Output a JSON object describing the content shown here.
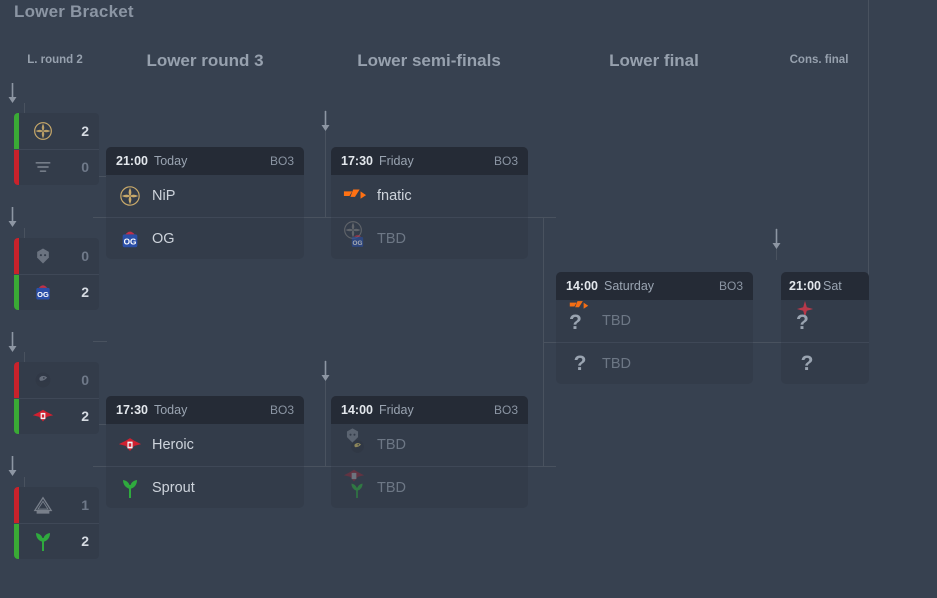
{
  "title": "Lower Bracket",
  "columns": [
    {
      "label": "L. round 2",
      "size": "small"
    },
    {
      "label": "Lower round 3",
      "size": "big"
    },
    {
      "label": "Lower semi-finals",
      "size": "big"
    },
    {
      "label": "Lower final",
      "size": "big"
    },
    {
      "label": "Cons. final",
      "size": "small"
    }
  ],
  "colors": {
    "background": "#374150",
    "card_body": "#333c4a",
    "card_header": "#252b36",
    "win_bar": "#3aaa35",
    "lose_bar": "#c9222b",
    "connector": "#49525f",
    "text_primary": "#cdd3db",
    "text_muted": "#6d7785"
  },
  "round2": {
    "matches": [
      {
        "teams": [
          {
            "logo": "nip-logo",
            "score": "2",
            "result": "win"
          },
          {
            "logo": "faze-logo",
            "score": "0",
            "result": "lose"
          }
        ]
      },
      {
        "teams": [
          {
            "logo": "big-logo",
            "score": "0",
            "result": "lose"
          },
          {
            "logo": "og-logo",
            "score": "2",
            "result": "win"
          }
        ]
      },
      {
        "teams": [
          {
            "logo": "godsent-logo",
            "score": "0",
            "result": "lose"
          },
          {
            "logo": "heroic-logo",
            "score": "2",
            "result": "win"
          }
        ]
      },
      {
        "teams": [
          {
            "logo": "mousesports-logo",
            "score": "1",
            "result": "lose"
          },
          {
            "logo": "sprout-logo",
            "score": "2",
            "result": "win"
          }
        ]
      }
    ]
  },
  "round3": {
    "matches": [
      {
        "time": "21:00",
        "day": "Today",
        "format": "BO3",
        "teams": [
          {
            "name": "NiP",
            "logo": "nip-logo",
            "state": "known"
          },
          {
            "name": "OG",
            "logo": "og-logo",
            "state": "known"
          }
        ]
      },
      {
        "time": "17:30",
        "day": "Today",
        "format": "BO3",
        "teams": [
          {
            "name": "Heroic",
            "logo": "heroic-logo",
            "state": "known"
          },
          {
            "name": "Sprout",
            "logo": "sprout-logo",
            "state": "known"
          }
        ]
      }
    ]
  },
  "semifinals": {
    "matches": [
      {
        "time": "17:30",
        "day": "Friday",
        "format": "BO3",
        "teams": [
          {
            "name": "fnatic",
            "logo": "fnatic-logo",
            "state": "known"
          },
          {
            "name": "TBD",
            "state": "pending",
            "pending_logos": [
              "nip-logo",
              "og-logo"
            ]
          }
        ]
      },
      {
        "time": "14:00",
        "day": "Friday",
        "format": "BO3",
        "teams": [
          {
            "name": "TBD",
            "state": "pending",
            "pending_logos": [
              "big-logo",
              "godsent-logo"
            ]
          },
          {
            "name": "TBD",
            "state": "pending",
            "pending_logos": [
              "heroic-logo",
              "sprout-logo"
            ]
          }
        ]
      }
    ]
  },
  "final": {
    "matches": [
      {
        "time": "14:00",
        "day": "Saturday",
        "format": "BO3",
        "teams": [
          {
            "name": "TBD",
            "state": "pending",
            "pending_logos": [
              "fnatic-logo"
            ],
            "question": "?"
          },
          {
            "name": "TBD",
            "state": "pending",
            "pending_logos": [],
            "question": "?"
          }
        ]
      }
    ]
  },
  "consfinal": {
    "matches": [
      {
        "time": "21:00",
        "day": "Sat",
        "teams": [
          {
            "name": "",
            "state": "pending",
            "pending_logos": [
              "astralis-logo"
            ],
            "question": "?"
          },
          {
            "name": "",
            "state": "pending",
            "pending_logos": [],
            "question": "?"
          }
        ]
      }
    ]
  },
  "icons": {
    "feed_arrow": "down-arrow-icon"
  }
}
